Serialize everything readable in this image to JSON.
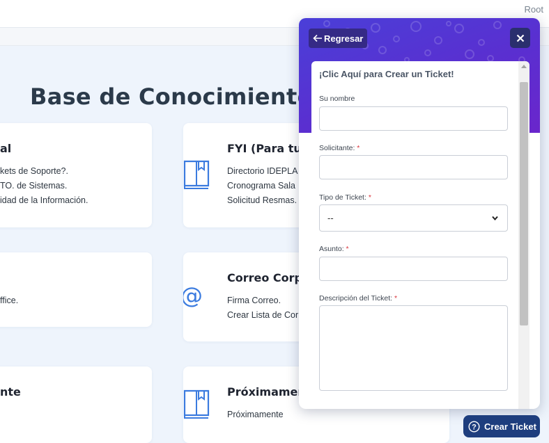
{
  "topbar": {
    "user": "Root"
  },
  "kb": {
    "title": "Base de Conocimientos",
    "cards": [
      {
        "title": "al",
        "lines": [
          "kets de Soporte?.",
          "TO. de Sistemas.",
          "idad de la Información."
        ]
      },
      {
        "title": "FYI (Para tu",
        "lines": [
          "Directorio IDEPLA",
          "Cronograma Sala",
          "Solicitud Resmas."
        ]
      },
      {
        "title": "",
        "lines": [
          "ffice."
        ]
      },
      {
        "title": "Correo Corpo",
        "lines": [
          "Firma Correo.",
          "Crear Lista de Cor"
        ]
      },
      {
        "title": "nte",
        "lines": []
      },
      {
        "title": "Próximamer",
        "lines": [
          "Próximamente"
        ]
      }
    ]
  },
  "panel": {
    "back_label": "Regresar",
    "form": {
      "heading": "¡Clic Aquí para Crear un Ticket!",
      "fields": {
        "nombre": {
          "label": "Su nombre",
          "value": ""
        },
        "solicitante": {
          "label": "Solicitante:",
          "required": "*",
          "value": ""
        },
        "tipo": {
          "label": "Tipo de Ticket:",
          "required": "*",
          "selected": "--"
        },
        "asunto": {
          "label": "Asunto:",
          "required": "*",
          "value": ""
        },
        "descripcion": {
          "label": "Descripción del Ticket:",
          "required": "*",
          "value": ""
        }
      }
    }
  },
  "launcher": {
    "label": "Crear Ticket",
    "icon": "help-circle-icon"
  },
  "colors": {
    "accent": "#5a2fd0",
    "launcher": "#1e3e7e",
    "icon_blue": "#3b7bdf",
    "required": "#d9363e"
  }
}
